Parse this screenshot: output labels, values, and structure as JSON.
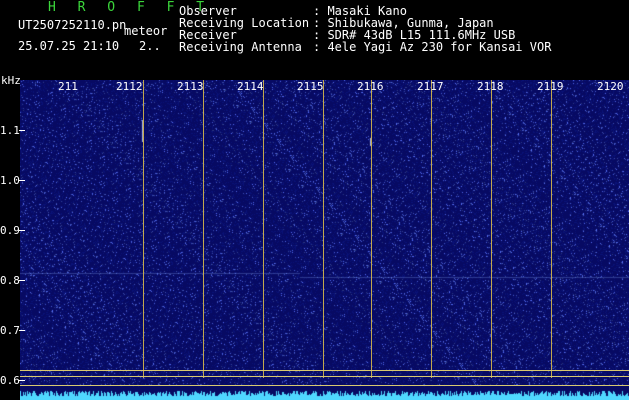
{
  "header": {
    "brand": "H R O F F T",
    "filename": "UT2507252110.pn",
    "meteor_label": "meteor",
    "datetime": "25.07.25 21:10",
    "page": "2.."
  },
  "info": {
    "rows": [
      {
        "label": "Observer",
        "value": ": Masaki Kano"
      },
      {
        "label": "Receiving Location",
        "value": ": Shibukawa, Gunma, Japan"
      },
      {
        "label": "Receiver",
        "value": ": SDR# 43dB L15 111.6MHz USB"
      },
      {
        "label": "Receiving Antenna",
        "value": ": 4ele Yagi Az 230 for Kansai VOR"
      }
    ]
  },
  "axis": {
    "unit": "kHz",
    "y_ticks": [
      "1.1",
      "1.0",
      "0.9",
      "0.8",
      "0.7",
      "0.6"
    ],
    "x_ticks": [
      "211",
      "2112",
      "2113",
      "2114",
      "2115",
      "2116",
      "2117",
      "2118",
      "2119",
      "2120"
    ]
  },
  "colors": {
    "background": "#000000",
    "spectrogram": "#070a63",
    "grid": "#d6b84a",
    "brand": "#3bd63b",
    "signal": "#4fd7ff"
  }
}
